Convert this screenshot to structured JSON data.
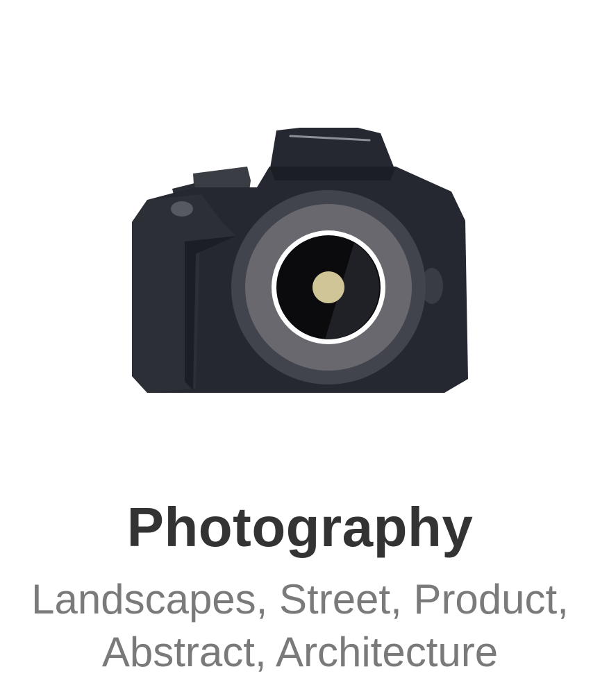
{
  "card": {
    "icon": "camera-icon",
    "title": "Photography",
    "subtitle_lines": [
      "Landscapes, Street, Product,",
      "Abstract, Architecture"
    ]
  },
  "colors": {
    "title": "#333333",
    "subtitle": "#7a7a7a",
    "camera_body": "#252830",
    "camera_dark": "#1b1e24",
    "lens_outer": "#41444d",
    "lens_ring": "#6a686f",
    "lens_glass": "#0b0b0d",
    "lens_center": "#cfc597",
    "lens_rim": "#ffffff"
  }
}
